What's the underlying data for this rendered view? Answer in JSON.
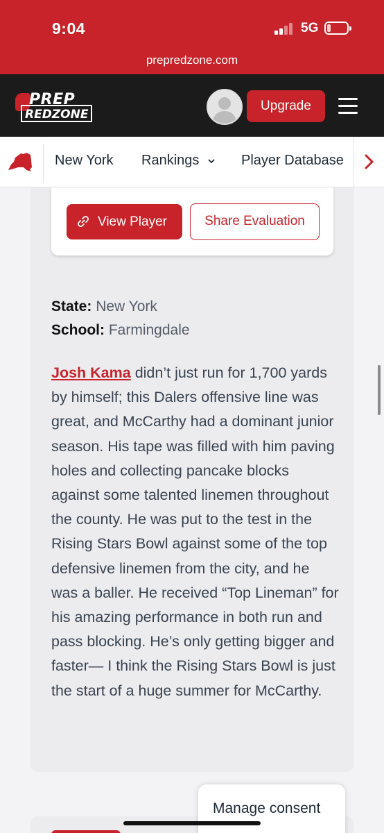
{
  "status_bar": {
    "time": "9:04",
    "network": "5G",
    "url": "prepredzone.com"
  },
  "header": {
    "logo_line1": "PREP",
    "logo_line2": "REDZONE",
    "upgrade_label": "Upgrade"
  },
  "subnav": {
    "items": [
      {
        "label": "New York"
      },
      {
        "label": "Rankings"
      },
      {
        "label": "Player Database"
      }
    ]
  },
  "player_card": {
    "view_player_label": "View Player",
    "share_label": "Share Evaluation"
  },
  "details": {
    "state_label": "State:",
    "state_value": "New York",
    "school_label": "School:",
    "school_value": "Farmingdale"
  },
  "evaluation": {
    "linked_name": "Josh Kama",
    "text": " didn’t just run for 1,700 yards by himself; this Dalers offensive line was great, and McCarthy had a dominant junior season. His tape was filled with him paving holes and collecting pancake blocks against some talented linemen throughout the county. He was put to the test in the Rising Stars Bowl against some of the top defensive linemen from the city, and he was a baller. He received “Top Lineman” for his amazing performance in both run and pass blocking. He’s only getting bigger and faster— I think the Rising Stars Bowl is just the start of a huge summer for McCarthy."
  },
  "consent": {
    "label": "Manage consent"
  },
  "colors": {
    "brand_red": "#c8232b",
    "navbar": "#1b1b1b"
  }
}
